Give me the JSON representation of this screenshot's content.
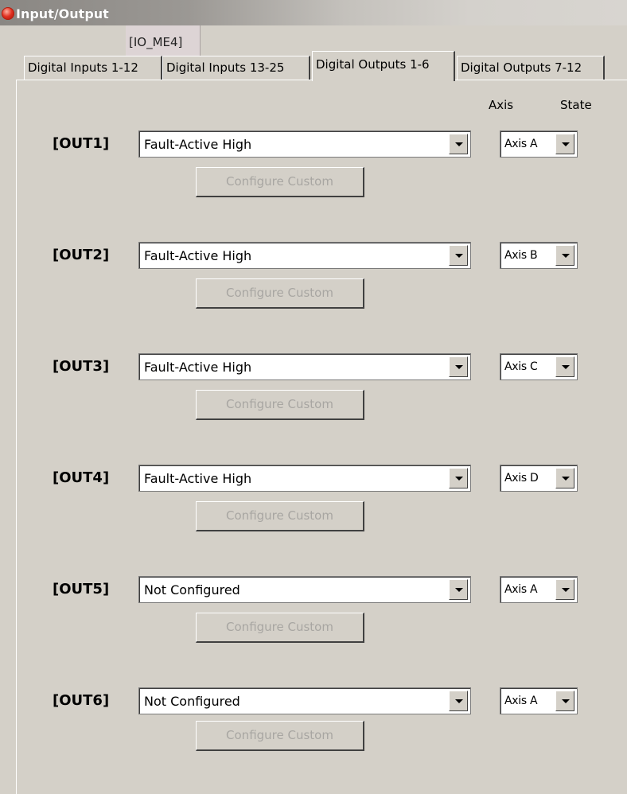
{
  "window": {
    "title": "Input/Output"
  },
  "io_tag": "[IO_ME4]",
  "tabs": [
    {
      "label": "Digital Inputs 1-12",
      "active": false
    },
    {
      "label": "Digital Inputs 13-25",
      "active": false
    },
    {
      "label": "Digital Outputs 1-6",
      "active": true
    },
    {
      "label": "Digital Outputs 7-12",
      "active": false
    }
  ],
  "columns": {
    "axis": "Axis",
    "state": "State"
  },
  "outputs": [
    {
      "label": "[OUT1]",
      "function": "Fault-Active High",
      "axis": "Axis A",
      "button": "Configure Custom"
    },
    {
      "label": "[OUT2]",
      "function": "Fault-Active High",
      "axis": "Axis B",
      "button": "Configure Custom"
    },
    {
      "label": "[OUT3]",
      "function": "Fault-Active High",
      "axis": "Axis C",
      "button": "Configure Custom"
    },
    {
      "label": "[OUT4]",
      "function": "Fault-Active High",
      "axis": "Axis D",
      "button": "Configure Custom"
    },
    {
      "label": "[OUT5]",
      "function": "Not Configured",
      "axis": "Axis A",
      "button": "Configure Custom"
    },
    {
      "label": "[OUT6]",
      "function": "Not Configured",
      "axis": "Axis A",
      "button": "Configure Custom"
    }
  ]
}
